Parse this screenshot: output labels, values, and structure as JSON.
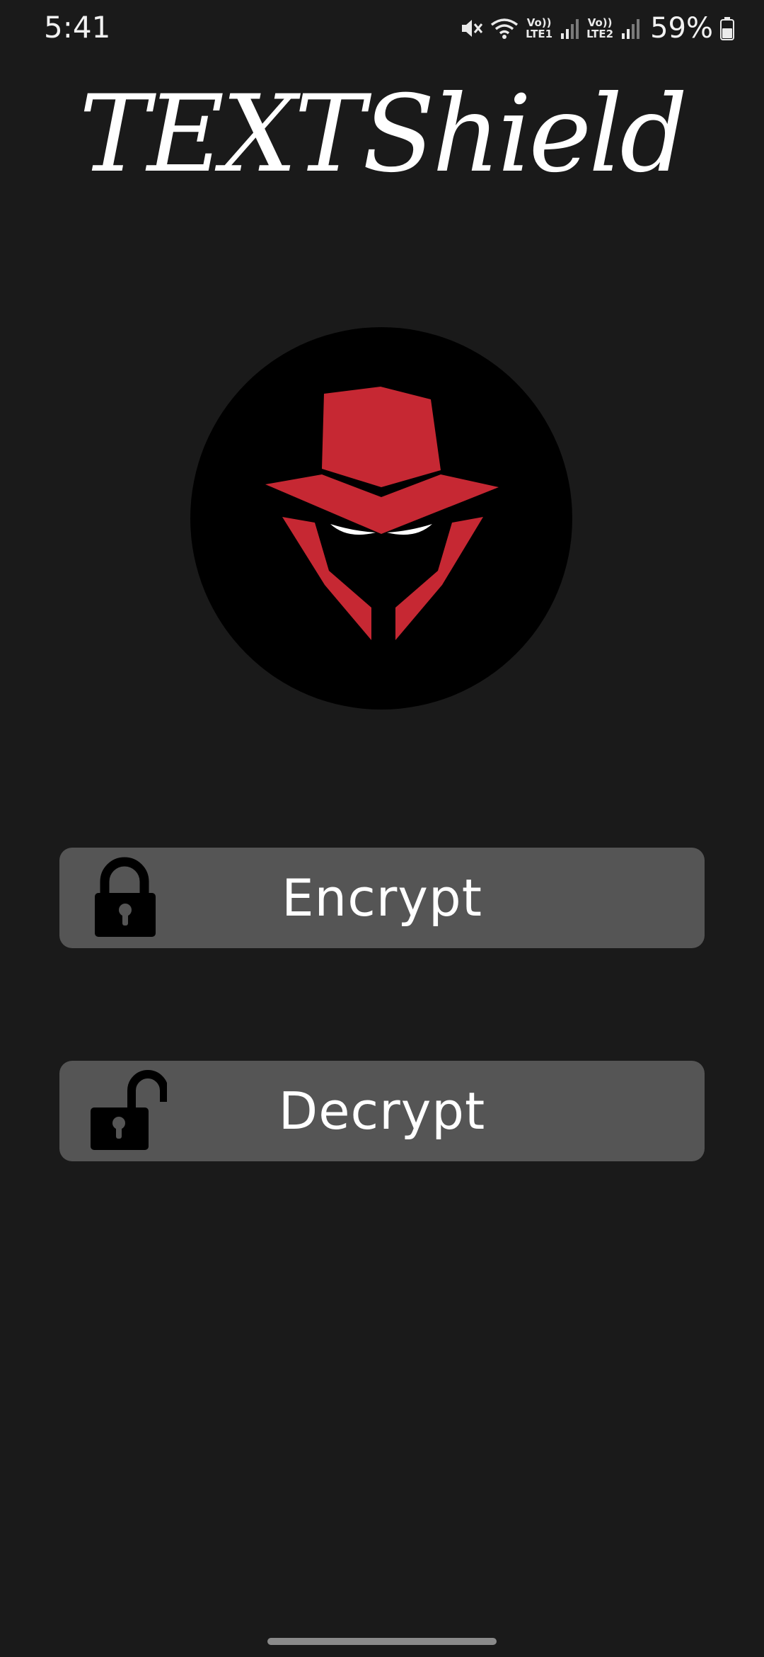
{
  "status_bar": {
    "time": "5:41",
    "sim1_label_top": "Vo))",
    "sim1_label_bottom": "LTE1",
    "sim2_label_top": "Vo))",
    "sim2_label_bottom": "LTE2",
    "battery_text": "59%",
    "icons": [
      "mute-icon",
      "wifi-icon",
      "signal-icon",
      "battery-icon"
    ]
  },
  "app": {
    "title": "TEXTShield"
  },
  "buttons": {
    "encrypt_label": "Encrypt",
    "decrypt_label": "Decrypt"
  },
  "colors": {
    "background": "#1a1a1a",
    "button": "#555555",
    "logo_accent": "#c62833",
    "logo_bg": "#000000"
  }
}
